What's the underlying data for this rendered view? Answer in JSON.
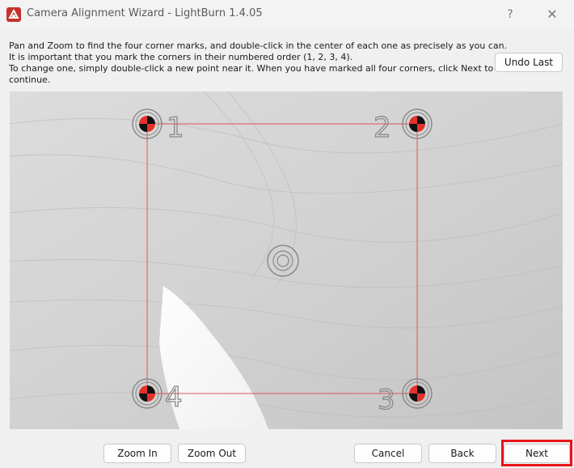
{
  "window": {
    "title": "Camera Alignment Wizard - LightBurn 1.4.05",
    "help_glyph": "?",
    "close_glyph": "✕"
  },
  "instructions": {
    "line1": "Pan and Zoom to find the four corner marks, and double-click in the center of each one as precisely as you can.",
    "line2": "It is important that you mark the corners in their numbered order (1, 2, 3, 4).",
    "line3": "To change one, simply double-click a new point near it.  When you have marked all four corners, click Next to",
    "line4": "continue."
  },
  "buttons": {
    "undo_last": "Undo Last",
    "zoom_in": "Zoom In",
    "zoom_out": "Zoom Out",
    "cancel": "Cancel",
    "back": "Back",
    "next": "Next"
  },
  "camera": {
    "corner_labels": [
      "1",
      "2",
      "3",
      "4"
    ],
    "guide_color": "#e05555",
    "highlight_color": "#e8141a"
  }
}
